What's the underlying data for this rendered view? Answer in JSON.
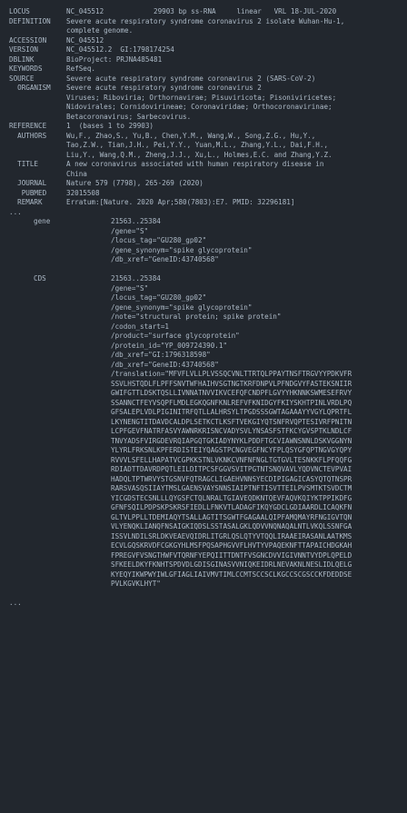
{
  "header": {
    "locus_label": "LOCUS",
    "locus_value": "NC_045512            29903 bp ss-RNA     linear   VRL 18-JUL-2020",
    "definition_label": "DEFINITION",
    "definition_lines": [
      "Severe acute respiratory syndrome coronavirus 2 isolate Wuhan-Hu-1,",
      "complete genome."
    ],
    "accession_label": "ACCESSION",
    "accession_value": "NC_045512",
    "version_label": "VERSION",
    "version_value": "NC_045512.2  GI:1798174254",
    "dblink_label": "DBLINK",
    "dblink_value": "BioProject: PRJNA485481",
    "keywords_label": "KEYWORDS",
    "keywords_value": "RefSeq.",
    "source_label": "SOURCE",
    "source_value": "Severe acute respiratory syndrome coronavirus 2 (SARS-CoV-2)",
    "organism_label": "  ORGANISM",
    "organism_lines": [
      "Severe acute respiratory syndrome coronavirus 2",
      "Viruses; Riboviria; Orthornavirae; Pisuviricota; Pisoniviricetes;",
      "Nidovirales; Cornidovirineae; Coronaviridae; Orthocoronavirinae;",
      "Betacoronavirus; Sarbecovirus."
    ],
    "reference_label": "REFERENCE",
    "reference_value": "1  (bases 1 to 29903)",
    "authors_label": "  AUTHORS",
    "authors_lines": [
      "Wu,F., Zhao,S., Yu,B., Chen,Y.M., Wang,W., Song,Z.G., Hu,Y.,",
      "Tao,Z.W., Tian,J.H., Pei,Y.Y., Yuan,M.L., Zhang,Y.L., Dai,F.H.,",
      "Liu,Y., Wang,Q.M., Zheng,J.J., Xu,L., Holmes,E.C. and Zhang,Y.Z."
    ],
    "title_label": "  TITLE",
    "title_lines": [
      "A new coronavirus associated with human respiratory disease in",
      "China"
    ],
    "journal_label": "  JOURNAL",
    "journal_value": "Nature 579 (7798), 265-269 (2020)",
    "pubmed_label": "   PUBMED",
    "pubmed_value": "32015508",
    "remark_label": "  REMARK",
    "remark_value": "Erratum:[Nature. 2020 Apr;580(7803):E7. PMID: 32296181]"
  },
  "ellipsis_top": "...",
  "gene_feature": {
    "key": "gene",
    "lines": [
      "21563..25384",
      "/gene=\"S\"",
      "/locus_tag=\"GU280_gp02\"",
      "/gene_synonym=\"spike glycoprotein\"",
      "/db_xref=\"GeneID:43740568\""
    ]
  },
  "cds_feature": {
    "key": "CDS",
    "lines": [
      "21563..25384",
      "/gene=\"S\"",
      "/locus_tag=\"GU280_gp02\"",
      "/gene_synonym=\"spike glycoprotein\"",
      "/note=\"structural protein; spike protein\"",
      "/codon_start=1",
      "/product=\"surface glycoprotein\"",
      "/protein_id=\"YP_009724390.1\"",
      "/db_xref=\"GI:1796318598\"",
      "/db_xref=\"GeneID:43740568\"",
      "/translation=\"MFVFLVLLPLVSSQCVNLTTRTQLPPAYTNSFTRGVYYPDKVFR",
      "SSVLHSTQDLFLPFFSNVTWFHAIHVSGTNGTKRFDNPVLPFNDGVYFASTEKSNIIR",
      "GWIFGTTLDSKTQSLLIVNNATNVVIKVCEFQFCNDPFLGVYYHKNNKSWMESEFRVY",
      "SSANNCTFEYVSQPFLMDLEGKQGNFKNLREFVFKNIDGYFKIYSKHTPINLVRDLPQ",
      "GFSALEPLVDLPIGINITRFQTLLALHRSYLTPGDSSSGWTAGAAAYYVGYLQPRTFL",
      "LKYNENGTITDAVDCALDPLSETKCTLKSFTVEKGIYQTSNFRVQPTESIVRFPNITN",
      "LCPFGEVFNATRFASVYAWNRKRISNCVADYSVLYNSASFSTFKCYGVSPTKLNDLCF",
      "TNVYADSFVIRGDEVRQIAPGQTGKIADYNYKLPDDFTGCVIAWNSNNLDSKVGGNYN",
      "YLYRLFRKSNLKPFERDISTEIYQAGSTPCNGVEGFNCYFPLQSYGFQPTNGVGYQPY",
      "RVVVLSFELLHAPATVCGPKKSTNLVKNKCVNFNFNGLTGTGVLTESNKKFLPFQQFG",
      "RDIADTTDAVRDPQTLEILDITPCSFGGVSVITPGTNTSNQVAVLYQDVNCTEVPVAI",
      "HADQLTPTWRVYSTGSNVFQTRAGCLIGAEHVNNSYECDIPIGAGICASYQTQTNSPR",
      "RARSVASQSIIAYTMSLGAENSVAYSNNSIAIPTNFTISVTTEILPVSMTKTSVDCTM",
      "YICGDSTECSNLLLQYGSFCTQLNRALTGIAVEQDKNTQEVFAQVKQIYKTPPIKDFG",
      "GFNFSQILPDPSKPSKRSFIEDLLFNKVTLADAGFIKQYGDCLGDIAARDLICAQKFN",
      "GLTVLPPLLTDEMIAQYTSALLAGTITSGWTFGAGAALQIPFAMQMAYRFNGIGVTQN",
      "VLYENQKLIANQFNSAIGKIQDSLSSTASALGKLQDVVNQNAQALNTLVKQLSSNFGA",
      "ISSVLNDILSRLDKVEAEVQIDRLITGRLQSLQTYVTQQLIRAAEIRASANLAATKMS",
      "ECVLGQSKRVDFCGKGYHLMSFPQSAPHGVVFLHVTYVPAQEKNFTTAPAICHDGKAH",
      "FPREGVFVSNGTHWFVTQRNFYEPQIITTDNTFVSGNCDVVIGIVNNTVYDPLQPELD",
      "SFKEELDKYFKNHTSPDVDLGDISGINASVVNIQKEIDRLNEVAKNLNESLIDLQELG",
      "KYEQYIKWPWYIWLGFIAGLIAIVMVTIMLCCMTSCCSCLKGCCSCGSCCKFDEDDSE",
      "PVLKGVKLHYT\""
    ]
  },
  "ellipsis_bottom": "..."
}
